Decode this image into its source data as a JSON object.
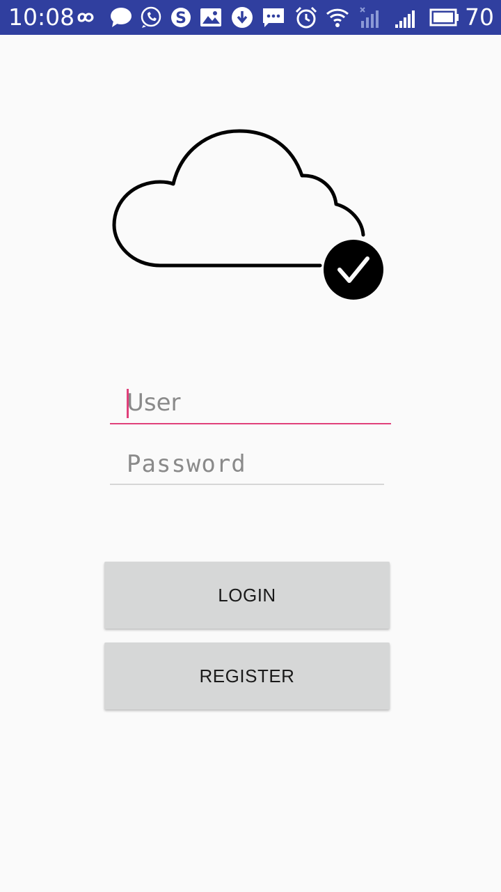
{
  "status_bar": {
    "time": "10:08",
    "battery_level": "70",
    "background_color": "#303f9f",
    "icons": [
      "infinity-icon",
      "chat-bubble-icon",
      "whatsapp-icon",
      "skype-icon",
      "image-icon",
      "download-icon",
      "sms-icon",
      "alarm-icon",
      "wifi-icon",
      "signal-no-service-icon",
      "signal-icon",
      "battery-icon"
    ]
  },
  "logo": {
    "icon": "cloud-check-icon"
  },
  "login_form": {
    "user_field": {
      "value": "",
      "placeholder": "User"
    },
    "password_field": {
      "value": "",
      "placeholder": "Password"
    },
    "login_label": "LOGIN",
    "register_label": "REGISTER"
  },
  "colors": {
    "accent": "#e0407a",
    "button_background": "#d6d7d7",
    "page_background": "#fafafa"
  }
}
